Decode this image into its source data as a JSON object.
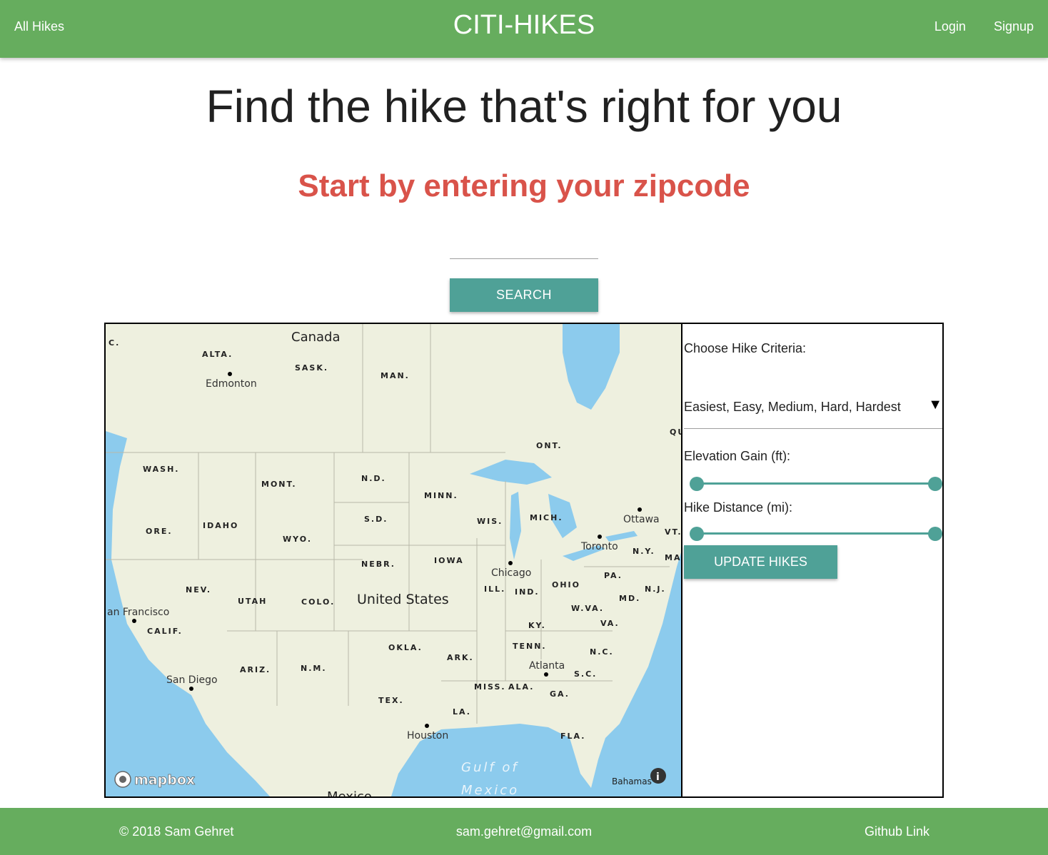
{
  "navbar": {
    "left_link": "All Hikes",
    "brand": "CITI-HIKES",
    "login": "Login",
    "signup": "Signup"
  },
  "hero": {
    "title": "Find the hike that's right for you",
    "subtitle": "Start by entering your zipcode"
  },
  "search": {
    "input_value": "",
    "button_label": "SEARCH"
  },
  "map": {
    "attribution_logo": "mapbox",
    "info_icon": "info-icon",
    "labels": {
      "canada": "Canada",
      "us": "United States",
      "mexico": "Mexico",
      "gulf1": "Gulf of",
      "gulf2": "Mexico",
      "bahamas": "Bahamas",
      "bc": "C.",
      "alta": "ALTA.",
      "sask": "SASK.",
      "man": "MAN.",
      "ont": "ONT.",
      "qu": "QU",
      "wash": "WASH.",
      "mont": "MONT.",
      "nd": "N.D.",
      "minn": "MINN.",
      "ore": "ORE.",
      "idaho": "IDAHO",
      "wyo": "WYO.",
      "sd": "S.D.",
      "wis": "WIS.",
      "mich": "MICH.",
      "nebr": "NEBR.",
      "iowa": "IOWA",
      "nev": "NEV.",
      "utah": "UTAH",
      "colo": "COLO.",
      "ill": "ILL.",
      "ind": "IND.",
      "ohio": "OHIO",
      "pa": "PA.",
      "ny": "N.Y.",
      "nj": "N.J.",
      "md": "MD.",
      "vt": "VT.",
      "ma": "MA",
      "wva": "W.VA.",
      "va": "VA.",
      "ky": "KY.",
      "calif": "CALIF.",
      "okla": "OKLA.",
      "ark": "ARK.",
      "tenn": "TENN.",
      "nc": "N.C.",
      "sc": "S.C.",
      "ariz": "ARIZ.",
      "nm": "N.M.",
      "miss": "MISS.",
      "ala": "ALA.",
      "ga": "GA.",
      "tex": "TEX.",
      "la": "LA.",
      "fla": "FLA."
    },
    "cities": {
      "edmonton": "Edmonton",
      "ottawa": "Ottawa",
      "toronto": "Toronto",
      "chicago": "Chicago",
      "sf": "an Francisco",
      "sandiego": "San Diego",
      "atlanta": "Atlanta",
      "houston": "Houston"
    },
    "colors": {
      "land": "#eef0df",
      "water": "#8ccbed",
      "border": "#b8b8a8"
    }
  },
  "criteria": {
    "label": "Choose Hike Criteria:",
    "difficulty_selected": "Easiest, Easy, Medium, Hard, Hardest",
    "elevation_label": "Elevation Gain (ft):",
    "distance_label": "Hike Distance (mi):",
    "update_label": "UPDATE HIKES"
  },
  "footer": {
    "copyright": "© 2018 Sam Gehret",
    "email": "sam.gehret@gmail.com",
    "github": "Github Link"
  },
  "colors": {
    "header_green": "#66ad5e",
    "teal": "#4fa197",
    "red_subtitle": "#d9534a"
  }
}
